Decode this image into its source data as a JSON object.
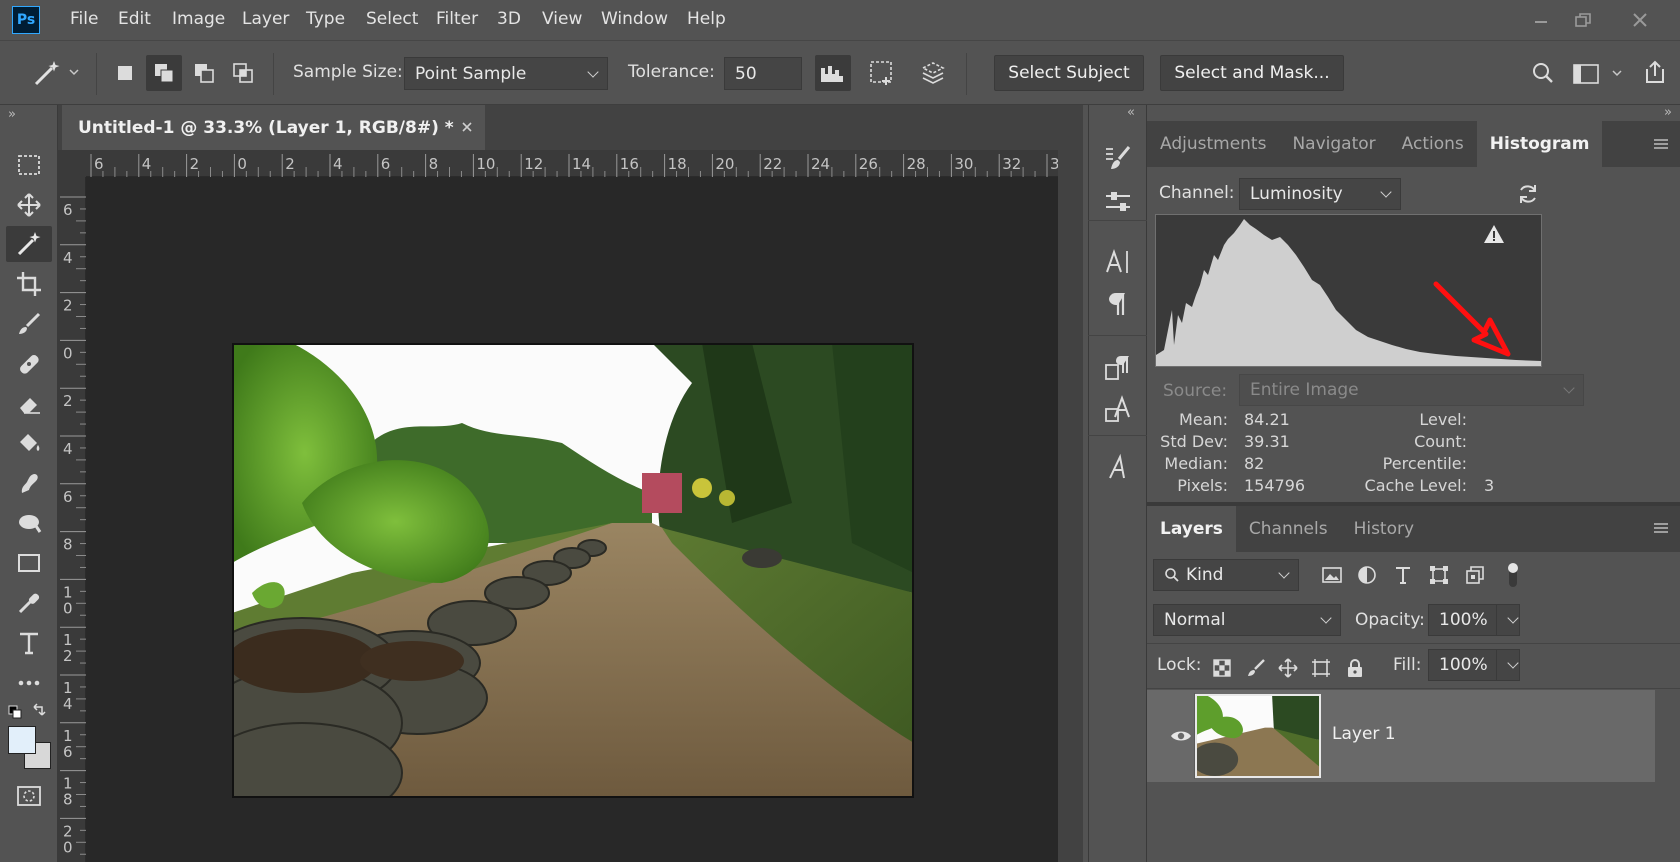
{
  "app": {
    "logo": "Ps"
  },
  "menu": [
    "File",
    "Edit",
    "Image",
    "Layer",
    "Type",
    "Select",
    "Filter",
    "3D",
    "View",
    "Window",
    "Help"
  ],
  "options_bar": {
    "sample_size_label": "Sample Size:",
    "sample_size_value": "Point Sample",
    "tolerance_label": "Tolerance:",
    "tolerance_value": "50",
    "select_subject": "Select Subject",
    "select_and_mask": "Select and Mask..."
  },
  "document": {
    "tab_title": "Untitled-1 @ 33.3% (Layer 1, RGB/8#) *",
    "ruler_top": [
      "6",
      "4",
      "2",
      "0",
      "2",
      "4",
      "6",
      "8",
      "10",
      "12",
      "14",
      "16",
      "18",
      "20",
      "22",
      "24",
      "26",
      "28",
      "30",
      "32",
      "3"
    ],
    "ruler_left": [
      "6",
      "4",
      "2",
      "0",
      "2",
      "4",
      "6",
      "8",
      "1\n0",
      "1\n2",
      "1\n4",
      "1\n6",
      "1\n8",
      "2\n0"
    ]
  },
  "histogram_panel": {
    "tabs": [
      "Adjustments",
      "Navigator",
      "Actions",
      "Histogram"
    ],
    "active_tab": "Histogram",
    "channel_label": "Channel:",
    "channel_value": "Luminosity",
    "source_label": "Source:",
    "source_value": "Entire Image",
    "stats": {
      "mean_label": "Mean:",
      "mean": "84.21",
      "stddev_label": "Std Dev:",
      "stddev": "39.31",
      "median_label": "Median:",
      "median": "82",
      "pixels_label": "Pixels:",
      "pixels": "154796",
      "level_label": "Level:",
      "level": "",
      "count_label": "Count:",
      "count": "",
      "percentile_label": "Percentile:",
      "percentile": "",
      "cache_label": "Cache Level:",
      "cache": "3"
    },
    "annotation_arrow_color": "#ff0000"
  },
  "layers_panel": {
    "tabs": [
      "Layers",
      "Channels",
      "History"
    ],
    "active_tab": "Layers",
    "filter_kind": "Kind",
    "blend_mode": "Normal",
    "opacity_label": "Opacity:",
    "opacity_value": "100%",
    "lock_label": "Lock:",
    "fill_label": "Fill:",
    "fill_value": "100%",
    "layers": [
      {
        "name": "Layer 1",
        "visible": true
      }
    ]
  },
  "colors": {
    "ui_bg": "#535353",
    "canvas_bg": "#282828",
    "foreground_swatch": "#e2effa",
    "background_swatch": "#d8d8d8"
  }
}
